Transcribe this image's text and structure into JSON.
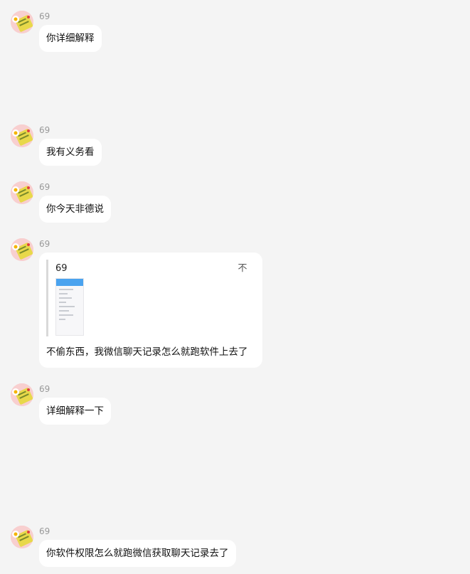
{
  "colors": {
    "background": "#f4f4f4",
    "bubble": "#ffffff",
    "sender_text": "#999999",
    "message_text": "#111111",
    "thumb_header": "#4aa3ef"
  },
  "messages": [
    {
      "sender": "69",
      "text": "你详细解释"
    },
    {
      "sender": "69",
      "text": "我有义务看"
    },
    {
      "sender": "69",
      "text": "你今天非德说"
    },
    {
      "sender": "69",
      "quote": {
        "sender": "69",
        "pin_icon": "不",
        "image": "screenshot-thumbnail"
      },
      "text": "不偷东西，我微信聊天记录怎么就跑软件上去了"
    },
    {
      "sender": "69",
      "text": "详细解释一下"
    },
    {
      "sender": "69",
      "text": "你软件权限怎么就跑微信获取聊天记录去了"
    }
  ]
}
